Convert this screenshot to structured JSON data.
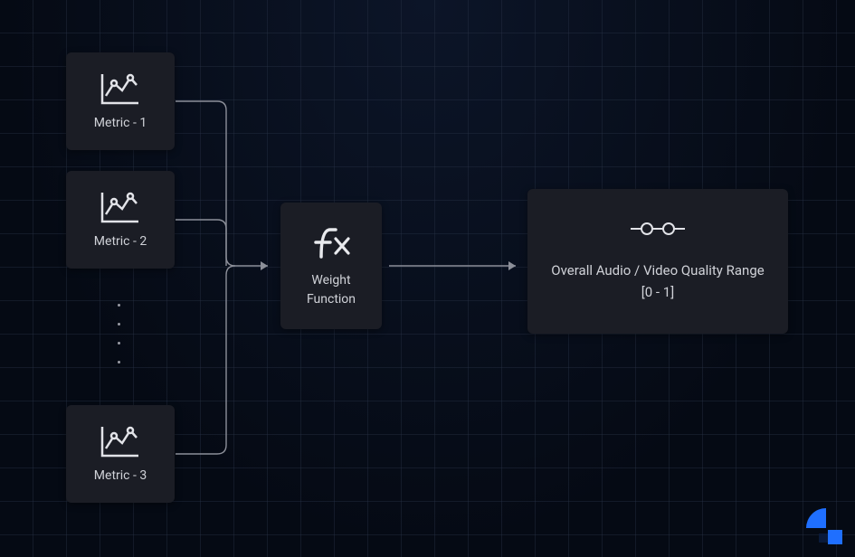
{
  "metrics": [
    {
      "label": "Metric - 1"
    },
    {
      "label": "Metric - 2"
    },
    {
      "label": "Metric - 3"
    }
  ],
  "weight": {
    "label": "Weight Function"
  },
  "output": {
    "label": "Overall Audio / Video Quality Range [0 - 1]"
  }
}
